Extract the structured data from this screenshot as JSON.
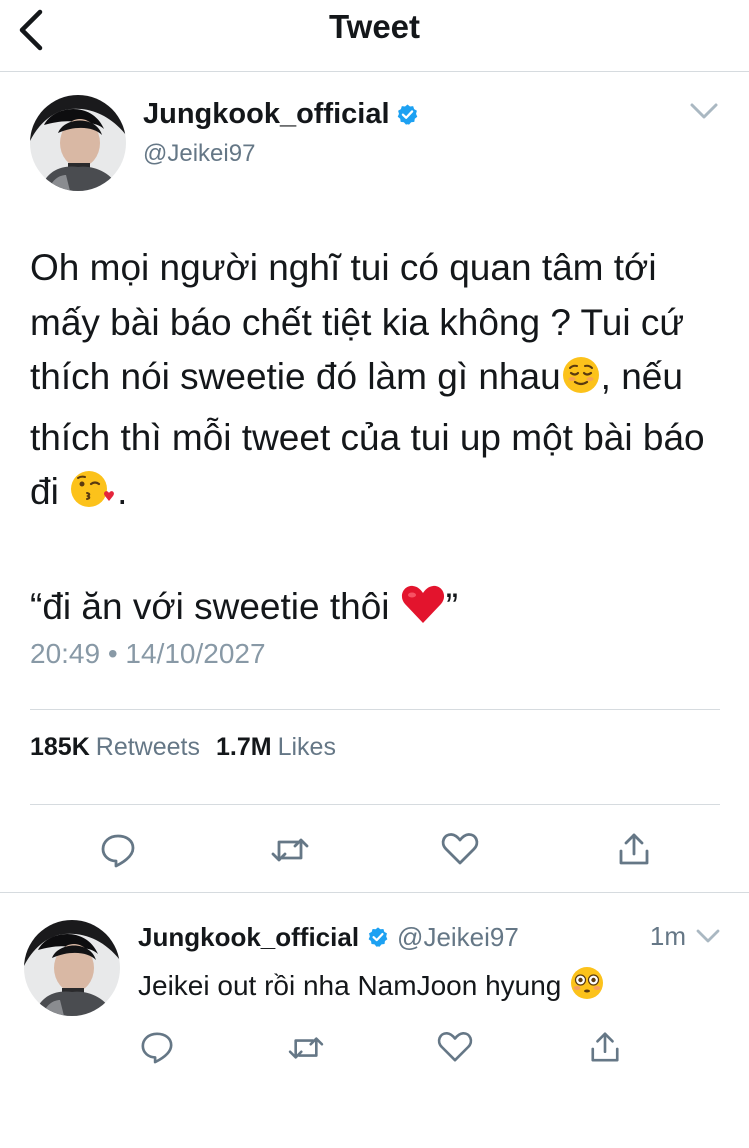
{
  "header": {
    "title": "Tweet",
    "back_icon": "chevron-left-icon"
  },
  "tweet": {
    "display_name": "Jungkook_official",
    "handle": "@Jeikei97",
    "verified": true,
    "text_parts": [
      "Oh mọi người nghĩ tui có quan tâm tới mấy bài báo chết tiệt kia không ? Tui cứ thích nói sweetie đó làm gì nhau",
      ", nếu thích thì mỗi tweet của tui up một bài báo đi ",
      ".",
      "“đi ăn với sweetie thôi ",
      "”"
    ],
    "emojis": [
      "relieved-face-emoji",
      "face-blowing-kiss-emoji",
      "red-heart-emoji"
    ],
    "timestamp": "20:49 • 14/10/2027",
    "retweets_count": "185K",
    "retweets_label": "Retweets",
    "likes_count": "1.7M",
    "likes_label": "Likes",
    "actions": [
      "reply-icon",
      "retweet-icon",
      "like-icon",
      "share-icon"
    ]
  },
  "reply": {
    "display_name": "Jungkook_official",
    "handle": "@Jeikei97",
    "verified": true,
    "time": "1m",
    "text": "Jeikei out rồi nha NamJoon hyung ",
    "emoji": "flushed-face-emoji",
    "actions": [
      "reply-icon",
      "retweet-icon",
      "like-icon",
      "share-icon"
    ]
  },
  "colors": {
    "text": "#14171a",
    "secondary": "#657786",
    "timestamp": "#8899a6",
    "verified": "#1da1f2",
    "divider": "#d6dbdf",
    "icon": "#657786"
  }
}
